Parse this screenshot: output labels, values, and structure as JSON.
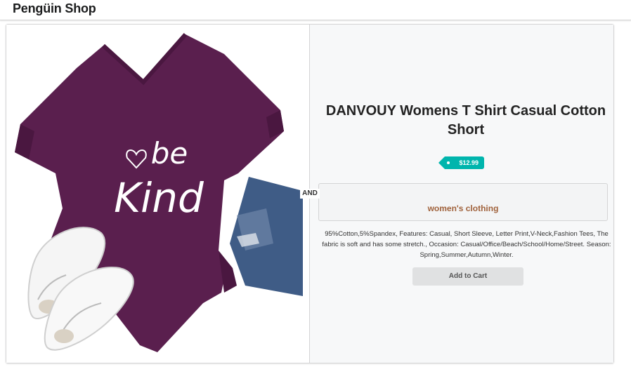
{
  "app": {
    "brand": "Pengüin Shop"
  },
  "product": {
    "title": "DANVOUY Womens T Shirt Casual Cotton Short",
    "price": "$12.99",
    "category": "women's clothing",
    "description": "95%Cotton,5%Spandex, Features: Casual, Short Sleeve, Letter Print,V-Neck,Fashion Tees, The fabric is soft and has some stretch., Occasion: Casual/Office/Beach/School/Home/Street. Season: Spring,Summer,Autumn,Winter.",
    "add_to_cart_label": "Add to Cart",
    "image_text": {
      "line1": "be",
      "line2": "Kind"
    }
  },
  "divider_label": "AND",
  "colors": {
    "shirt": "#5a1f4e",
    "price_tag": "#00b5ad",
    "category_text": "#a0623c",
    "denim": "#3f5c86"
  }
}
